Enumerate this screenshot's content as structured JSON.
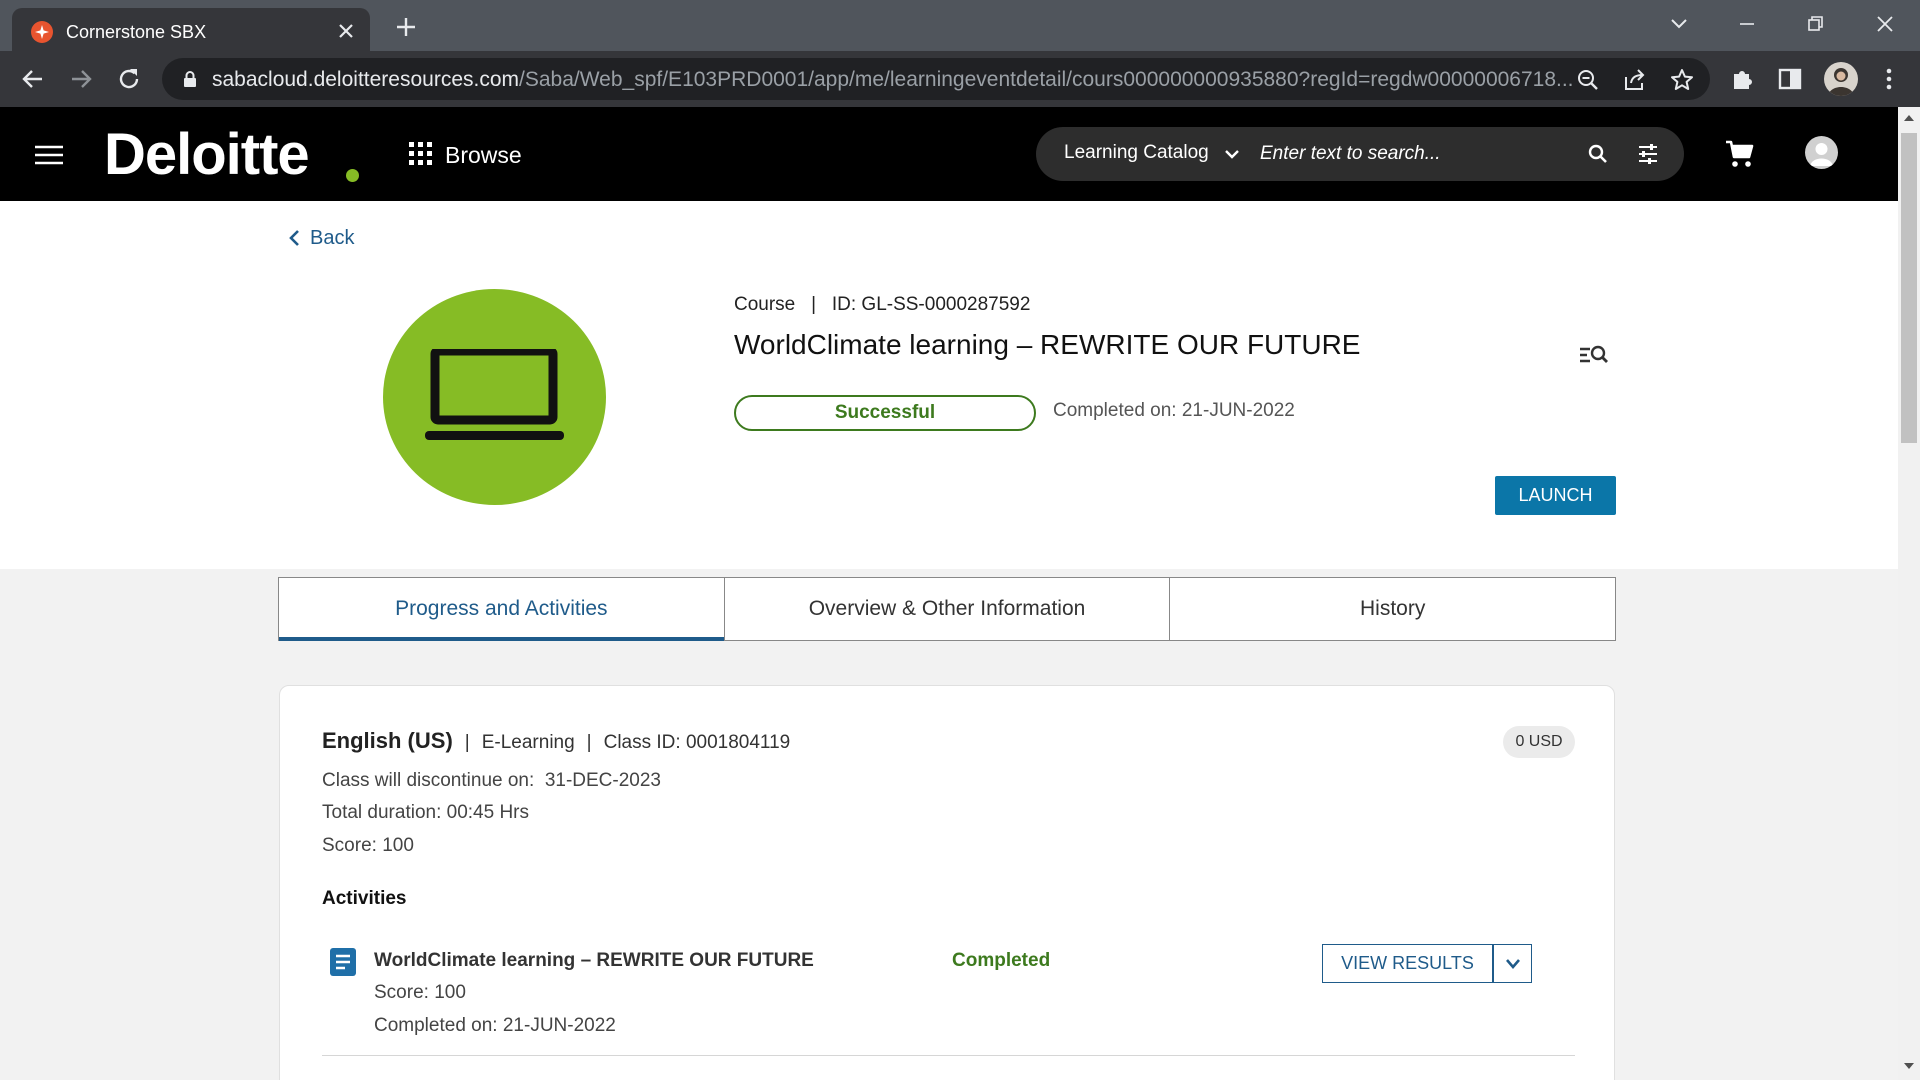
{
  "browser": {
    "tab_title": "Cornerstone SBX",
    "url_host": "sabacloud.deloitteresources.com",
    "url_path": "/Saba/Web_spf/E103PRD0001/app/me/learningeventdetail/cours000000000935880?regId=regdw00000006718..."
  },
  "header": {
    "brand": "Deloitte",
    "browse_label": "Browse",
    "catalog_label": "Learning Catalog",
    "search_placeholder": "Enter text to search..."
  },
  "hero": {
    "back_label": "Back",
    "course_type": "Course",
    "course_id": "ID: GL-SS-0000287592",
    "title": "WorldClimate learning – REWRITE OUR FUTURE",
    "status": "Successful",
    "completed_on": "Completed on: 21-JUN-2022",
    "launch_label": "LAUNCH"
  },
  "tabs": [
    {
      "label": "Progress and Activities",
      "active": true
    },
    {
      "label": "Overview & Other Information",
      "active": false
    },
    {
      "label": "History",
      "active": false
    }
  ],
  "class_card": {
    "language": "English (US)",
    "delivery": "E-Learning",
    "class_id": "Class ID: 0001804119",
    "price": "0 USD",
    "discontinue": "Class will discontinue on:  31-DEC-2023",
    "duration": "Total duration: 00:45 Hrs",
    "score": "Score: 100",
    "activities_heading": "Activities",
    "activity": {
      "title": "WorldClimate learning – REWRITE OUR FUTURE",
      "score": "Score: 100",
      "completed_on": "Completed on: 21-JUN-2022",
      "status": "Completed",
      "view_results_label": "VIEW RESULTS"
    }
  },
  "colors": {
    "brand_green": "#86bc25",
    "primary_blue": "#0b76a8",
    "link_blue": "#1f5b8a",
    "success_green": "#3d7a1e"
  },
  "icons": [
    "chrome-favicon-icon",
    "close-icon",
    "plus-icon",
    "back-arrow-icon",
    "forward-arrow-icon",
    "reload-icon",
    "lock-icon",
    "zoom-icon",
    "share-icon",
    "star-icon",
    "extensions-icon",
    "side-panel-icon",
    "menu-dots-icon",
    "hamburger-icon",
    "grid-icon",
    "chevron-down-icon",
    "search-icon",
    "filter-icon",
    "cart-icon",
    "user-icon",
    "laptop-icon",
    "details-search-icon",
    "document-icon"
  ]
}
